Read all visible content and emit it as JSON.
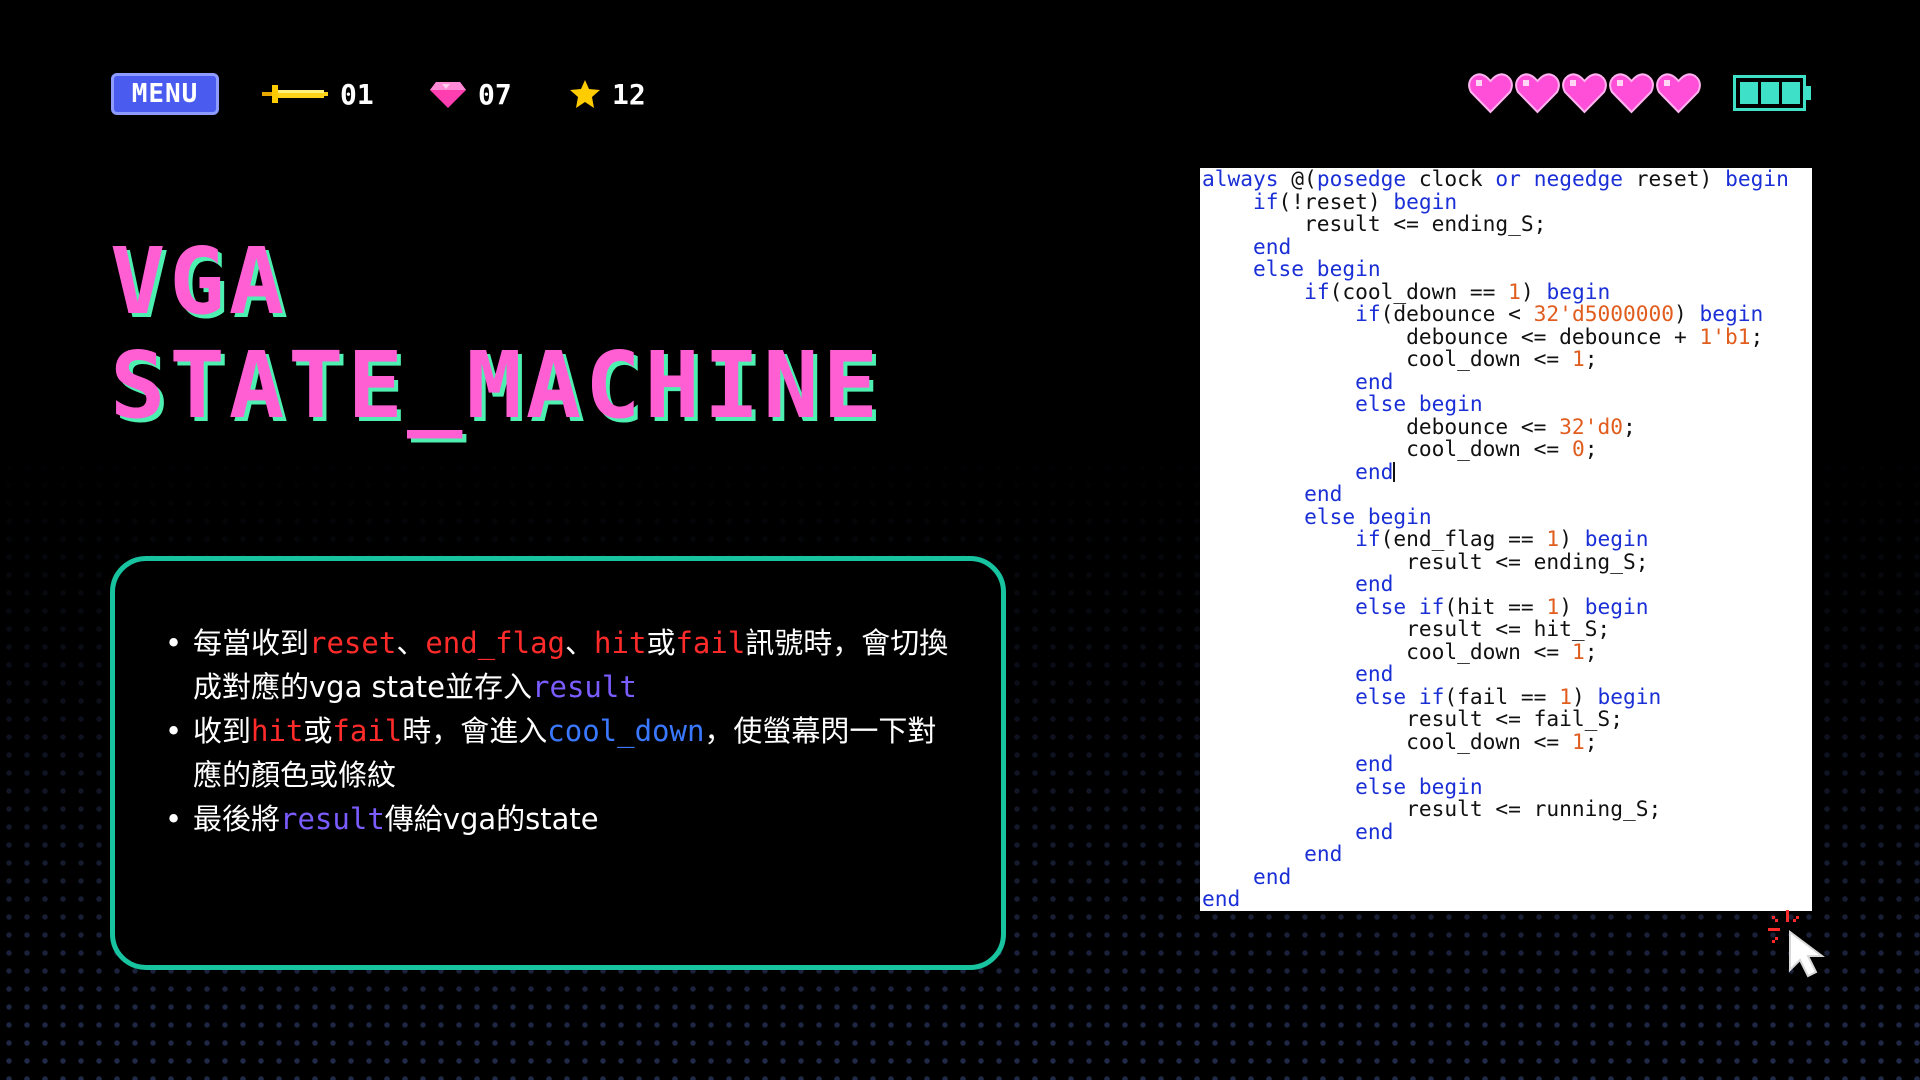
{
  "hud": {
    "menu_label": "MENU",
    "stats": [
      {
        "icon": "sword-icon",
        "value": "01"
      },
      {
        "icon": "gem-icon",
        "value": "07"
      },
      {
        "icon": "star-icon",
        "value": "12"
      }
    ],
    "hearts_count": 5,
    "battery_level": 1.0
  },
  "title": {
    "line1": "VGA",
    "line2": "STATE_MACHINE"
  },
  "bullets": [
    [
      {
        "t": "每當收到"
      },
      {
        "t": "reset",
        "c": "red"
      },
      {
        "t": "、"
      },
      {
        "t": "end_flag",
        "c": "red"
      },
      {
        "t": "、"
      },
      {
        "t": "hit",
        "c": "red"
      },
      {
        "t": "或"
      },
      {
        "t": "fail",
        "c": "red"
      },
      {
        "t": "訊號時，會切換成對應的vga state並存入"
      },
      {
        "t": "result",
        "c": "purple"
      }
    ],
    [
      {
        "t": "收到"
      },
      {
        "t": "hit",
        "c": "red"
      },
      {
        "t": "或"
      },
      {
        "t": "fail",
        "c": "red"
      },
      {
        "t": "時，會進入"
      },
      {
        "t": "cool_down",
        "c": "blue"
      },
      {
        "t": "，使螢幕閃一下對應的顏色或條紋"
      }
    ],
    [
      {
        "t": "最後將"
      },
      {
        "t": "result",
        "c": "purple"
      },
      {
        "t": "傳給vga的state"
      }
    ]
  ],
  "code_lines": [
    [
      {
        "t": "always",
        "k": "kw"
      },
      {
        "t": " @("
      },
      {
        "t": "posedge",
        "k": "kw"
      },
      {
        "t": " clock "
      },
      {
        "t": "or",
        "k": "kw"
      },
      {
        "t": " "
      },
      {
        "t": "negedge",
        "k": "kw"
      },
      {
        "t": " reset) "
      },
      {
        "t": "begin",
        "k": "kw"
      }
    ],
    [
      {
        "t": "    "
      },
      {
        "t": "if",
        "k": "kw"
      },
      {
        "t": "(!reset) "
      },
      {
        "t": "begin",
        "k": "kw"
      }
    ],
    [
      {
        "t": "        result <= ending_S;"
      }
    ],
    [
      {
        "t": "    "
      },
      {
        "t": "end",
        "k": "kw"
      }
    ],
    [
      {
        "t": "    "
      },
      {
        "t": "else begin",
        "k": "kw"
      }
    ],
    [
      {
        "t": "        "
      },
      {
        "t": "if",
        "k": "kw"
      },
      {
        "t": "(cool_down == "
      },
      {
        "t": "1",
        "k": "num"
      },
      {
        "t": ") "
      },
      {
        "t": "begin",
        "k": "kw"
      }
    ],
    [
      {
        "t": "            "
      },
      {
        "t": "if",
        "k": "kw"
      },
      {
        "t": "(debounce < "
      },
      {
        "t": "32'd5000000",
        "k": "num"
      },
      {
        "t": ") "
      },
      {
        "t": "begin",
        "k": "kw"
      }
    ],
    [
      {
        "t": "                debounce <= debounce + "
      },
      {
        "t": "1'b1",
        "k": "num"
      },
      {
        "t": ";"
      }
    ],
    [
      {
        "t": "                cool_down <= "
      },
      {
        "t": "1",
        "k": "num"
      },
      {
        "t": ";"
      }
    ],
    [
      {
        "t": "            "
      },
      {
        "t": "end",
        "k": "kw"
      }
    ],
    [
      {
        "t": "            "
      },
      {
        "t": "else begin",
        "k": "kw"
      }
    ],
    [
      {
        "t": "                debounce <= "
      },
      {
        "t": "32'd0",
        "k": "num"
      },
      {
        "t": ";"
      }
    ],
    [
      {
        "t": "                cool_down <= "
      },
      {
        "t": "0",
        "k": "num"
      },
      {
        "t": ";"
      }
    ],
    [
      {
        "t": "            "
      },
      {
        "t": "end",
        "k": "kw"
      },
      {
        "t": "",
        "k": "caret"
      }
    ],
    [
      {
        "t": "        "
      },
      {
        "t": "end",
        "k": "kw"
      }
    ],
    [
      {
        "t": "        "
      },
      {
        "t": "else begin",
        "k": "kw"
      }
    ],
    [
      {
        "t": "            "
      },
      {
        "t": "if",
        "k": "kw"
      },
      {
        "t": "(end_flag == "
      },
      {
        "t": "1",
        "k": "num"
      },
      {
        "t": ") "
      },
      {
        "t": "begin",
        "k": "kw"
      }
    ],
    [
      {
        "t": "                result <= ending_S;"
      }
    ],
    [
      {
        "t": "            "
      },
      {
        "t": "end",
        "k": "kw"
      }
    ],
    [
      {
        "t": "            "
      },
      {
        "t": "else if",
        "k": "kw"
      },
      {
        "t": "(hit == "
      },
      {
        "t": "1",
        "k": "num"
      },
      {
        "t": ") "
      },
      {
        "t": "begin",
        "k": "kw"
      }
    ],
    [
      {
        "t": "                result <= hit_S;"
      }
    ],
    [
      {
        "t": "                cool_down <= "
      },
      {
        "t": "1",
        "k": "num"
      },
      {
        "t": ";"
      }
    ],
    [
      {
        "t": "            "
      },
      {
        "t": "end",
        "k": "kw"
      }
    ],
    [
      {
        "t": "            "
      },
      {
        "t": "else if",
        "k": "kw"
      },
      {
        "t": "(fail == "
      },
      {
        "t": "1",
        "k": "num"
      },
      {
        "t": ") "
      },
      {
        "t": "begin",
        "k": "kw"
      }
    ],
    [
      {
        "t": "                result <= fail_S;"
      }
    ],
    [
      {
        "t": "                cool_down <= "
      },
      {
        "t": "1",
        "k": "num"
      },
      {
        "t": ";"
      }
    ],
    [
      {
        "t": "            "
      },
      {
        "t": "end",
        "k": "kw"
      }
    ],
    [
      {
        "t": "            "
      },
      {
        "t": "else begin",
        "k": "kw"
      }
    ],
    [
      {
        "t": "                result <= running_S;"
      }
    ],
    [
      {
        "t": "            "
      },
      {
        "t": "end",
        "k": "kw"
      }
    ],
    [
      {
        "t": "        "
      },
      {
        "t": "end",
        "k": "kw"
      }
    ],
    [
      {
        "t": "    "
      },
      {
        "t": "end",
        "k": "kw"
      }
    ],
    [
      {
        "t": "end",
        "k": "kw"
      }
    ]
  ],
  "colors": {
    "title_pink": "#ff5fd2",
    "title_shadow_green": "#4df0b0",
    "box_border_teal": "#18c4a0",
    "menu_blue": "#4a5cf0",
    "heart_pink": "#ff4fd8",
    "battery_teal": "#3fe0c8",
    "highlight_red": "#ff2b2b",
    "highlight_purple": "#7a5cff",
    "highlight_blue": "#3a78ff",
    "code_keyword": "#1a2fd6",
    "code_number": "#e05d1e"
  }
}
